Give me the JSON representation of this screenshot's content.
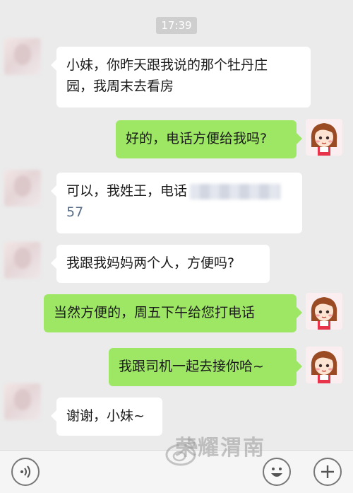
{
  "header": {
    "time": "17:39"
  },
  "messages": [
    {
      "sender": "them",
      "text": "小妹，你昨天跟我说的那个牡丹庄\n园，我周末去看房"
    },
    {
      "sender": "me",
      "text": "好的，电话方便给我吗?"
    },
    {
      "sender": "them",
      "text_prefix": "可以，我姓王，电话",
      "text_suffix": "57"
    },
    {
      "sender": "them",
      "text": "我跟我妈妈两个人，方便吗?"
    },
    {
      "sender": "me",
      "text": "当然方便的，周五下午给您打电话"
    },
    {
      "sender": "me",
      "text": "我跟司机一起去接你哈~"
    },
    {
      "sender": "them",
      "text": "谢谢，小妹~"
    }
  ],
  "watermark": {
    "text": "荣耀渭南"
  },
  "input_bar": {
    "voice_icon": "voice-icon",
    "emoji_icon": "emoji-icon",
    "plus_icon": "plus-icon"
  },
  "colors": {
    "background": "#ebebeb",
    "bubble_me": "#9ee765",
    "bubble_them": "#ffffff",
    "time_badge": "#cecece"
  }
}
